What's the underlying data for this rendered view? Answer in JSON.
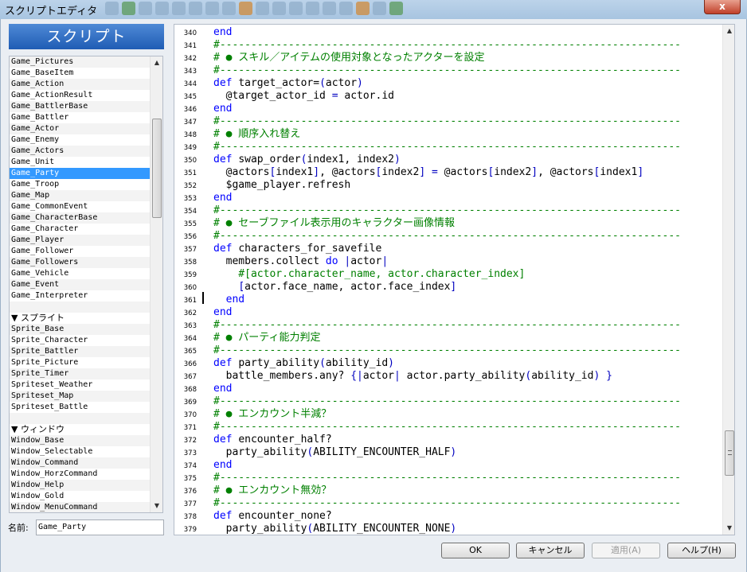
{
  "window": {
    "title": "スクリプトエディタ",
    "close_label": "x",
    "accent": "#1f5cb4",
    "selection_color": "#3399ff"
  },
  "left_panel": {
    "header": "スクリプト",
    "items": [
      {
        "label": "Game_Pictures"
      },
      {
        "label": "Game_BaseItem"
      },
      {
        "label": "Game_Action"
      },
      {
        "label": "Game_ActionResult"
      },
      {
        "label": "Game_BattlerBase"
      },
      {
        "label": "Game_Battler"
      },
      {
        "label": "Game_Actor"
      },
      {
        "label": "Game_Enemy"
      },
      {
        "label": "Game_Actors"
      },
      {
        "label": "Game_Unit"
      },
      {
        "label": "Game_Party",
        "selected": true
      },
      {
        "label": "Game_Troop"
      },
      {
        "label": "Game_Map"
      },
      {
        "label": "Game_CommonEvent"
      },
      {
        "label": "Game_CharacterBase"
      },
      {
        "label": "Game_Character"
      },
      {
        "label": "Game_Player"
      },
      {
        "label": "Game_Follower"
      },
      {
        "label": "Game_Followers"
      },
      {
        "label": "Game_Vehicle"
      },
      {
        "label": "Game_Event"
      },
      {
        "label": "Game_Interpreter"
      },
      {
        "gap": true
      },
      {
        "category": "▼ スプライト"
      },
      {
        "label": "Sprite_Base"
      },
      {
        "label": "Sprite_Character"
      },
      {
        "label": "Sprite_Battler"
      },
      {
        "label": "Sprite_Picture"
      },
      {
        "label": "Sprite_Timer"
      },
      {
        "label": "Spriteset_Weather"
      },
      {
        "label": "Spriteset_Map"
      },
      {
        "label": "Spriteset_Battle"
      },
      {
        "gap": true
      },
      {
        "category": "▼ ウィンドウ"
      },
      {
        "label": "Window_Base"
      },
      {
        "label": "Window_Selectable"
      },
      {
        "label": "Window_Command"
      },
      {
        "label": "Window_HorzCommand"
      },
      {
        "label": "Window_Help"
      },
      {
        "label": "Window_Gold"
      },
      {
        "label": "Window_MenuCommand"
      }
    ],
    "name_label": "名前:",
    "name_value": "Game_Party"
  },
  "editor": {
    "lines": [
      {
        "n": "340",
        "t": "kw",
        "text": "end"
      },
      {
        "n": "341",
        "t": "cm",
        "text": "#--------------------------------------------------------------------------"
      },
      {
        "n": "342",
        "t": "cm",
        "text": "# ● スキル／アイテムの使用対象となったアクターを設定"
      },
      {
        "n": "343",
        "t": "cm",
        "text": "#--------------------------------------------------------------------------"
      },
      {
        "n": "344",
        "t": "mix",
        "parts": [
          [
            "kw",
            "def "
          ],
          [
            "pl",
            "target_actor="
          ],
          [
            "sy",
            "("
          ],
          [
            "pl",
            "actor"
          ],
          [
            "sy",
            ")"
          ]
        ]
      },
      {
        "n": "345",
        "t": "mix",
        "parts": [
          [
            "pl",
            "  @target_actor_id "
          ],
          [
            "sy",
            "="
          ],
          [
            "pl",
            " actor.id"
          ]
        ]
      },
      {
        "n": "346",
        "t": "kw",
        "text": "end"
      },
      {
        "n": "347",
        "t": "cm",
        "text": "#--------------------------------------------------------------------------"
      },
      {
        "n": "348",
        "t": "cm",
        "text": "# ● 順序入れ替え"
      },
      {
        "n": "349",
        "t": "cm",
        "text": "#--------------------------------------------------------------------------"
      },
      {
        "n": "350",
        "t": "mix",
        "parts": [
          [
            "kw",
            "def "
          ],
          [
            "pl",
            "swap_order"
          ],
          [
            "sy",
            "("
          ],
          [
            "pl",
            "index1, index2"
          ],
          [
            "sy",
            ")"
          ]
        ]
      },
      {
        "n": "351",
        "t": "mix",
        "parts": [
          [
            "pl",
            "  @actors"
          ],
          [
            "sy",
            "["
          ],
          [
            "pl",
            "index1"
          ],
          [
            "sy",
            "]"
          ],
          [
            "pl",
            ", @actors"
          ],
          [
            "sy",
            "["
          ],
          [
            "pl",
            "index2"
          ],
          [
            "sy",
            "]"
          ],
          [
            "pl",
            " "
          ],
          [
            "sy",
            "="
          ],
          [
            "pl",
            " @actors"
          ],
          [
            "sy",
            "["
          ],
          [
            "pl",
            "index2"
          ],
          [
            "sy",
            "]"
          ],
          [
            "pl",
            ", @actors"
          ],
          [
            "sy",
            "["
          ],
          [
            "pl",
            "index1"
          ],
          [
            "sy",
            "]"
          ]
        ]
      },
      {
        "n": "352",
        "t": "mix",
        "parts": [
          [
            "pl",
            "  $game_player.refresh"
          ]
        ]
      },
      {
        "n": "353",
        "t": "kw",
        "text": "end"
      },
      {
        "n": "354",
        "t": "cm",
        "text": "#--------------------------------------------------------------------------"
      },
      {
        "n": "355",
        "t": "cm",
        "text": "# ● セーブファイル表示用のキャラクター画像情報"
      },
      {
        "n": "356",
        "t": "cm",
        "text": "#--------------------------------------------------------------------------"
      },
      {
        "n": "357",
        "t": "mix",
        "parts": [
          [
            "kw",
            "def "
          ],
          [
            "pl",
            "characters_for_savefile"
          ]
        ]
      },
      {
        "n": "358",
        "t": "mix",
        "parts": [
          [
            "pl",
            "  members.collect "
          ],
          [
            "kw",
            "do"
          ],
          [
            "pl",
            " "
          ],
          [
            "sy",
            "|"
          ],
          [
            "pl",
            "actor"
          ],
          [
            "sy",
            "|"
          ]
        ]
      },
      {
        "n": "359",
        "t": "cm",
        "text": "    #[actor.character_name, actor.character_index]"
      },
      {
        "n": "360",
        "t": "mix",
        "parts": [
          [
            "pl",
            "    "
          ],
          [
            "sy",
            "["
          ],
          [
            "pl",
            "actor.face_name, actor.face_index"
          ],
          [
            "sy",
            "]"
          ]
        ]
      },
      {
        "n": "361",
        "t": "kw",
        "text": "  end"
      },
      {
        "n": "362",
        "t": "kw",
        "text": "end"
      },
      {
        "n": "363",
        "t": "cm",
        "text": "#--------------------------------------------------------------------------"
      },
      {
        "n": "364",
        "t": "cm",
        "text": "# ● パーティ能力判定"
      },
      {
        "n": "365",
        "t": "cm",
        "text": "#--------------------------------------------------------------------------"
      },
      {
        "n": "366",
        "t": "mix",
        "parts": [
          [
            "kw",
            "def "
          ],
          [
            "pl",
            "party_ability"
          ],
          [
            "sy",
            "("
          ],
          [
            "pl",
            "ability_id"
          ],
          [
            "sy",
            ")"
          ]
        ]
      },
      {
        "n": "367",
        "t": "mix",
        "parts": [
          [
            "pl",
            "  battle_members.any? "
          ],
          [
            "sy",
            "{|"
          ],
          [
            "pl",
            "actor"
          ],
          [
            "sy",
            "|"
          ],
          [
            "pl",
            " actor.party_ability"
          ],
          [
            "sy",
            "("
          ],
          [
            "pl",
            "ability_id"
          ],
          [
            "sy",
            ")"
          ],
          [
            "pl",
            " "
          ],
          [
            "sy",
            "}"
          ]
        ]
      },
      {
        "n": "368",
        "t": "kw",
        "text": "end"
      },
      {
        "n": "369",
        "t": "cm",
        "text": "#--------------------------------------------------------------------------"
      },
      {
        "n": "370",
        "t": "cm",
        "text": "# ● エンカウント半減？"
      },
      {
        "n": "371",
        "t": "cm",
        "text": "#--------------------------------------------------------------------------"
      },
      {
        "n": "372",
        "t": "mix",
        "parts": [
          [
            "kw",
            "def "
          ],
          [
            "pl",
            "encounter_half?"
          ]
        ]
      },
      {
        "n": "373",
        "t": "mix",
        "parts": [
          [
            "pl",
            "  party_ability"
          ],
          [
            "sy",
            "("
          ],
          [
            "pl",
            "ABILITY_ENCOUNTER_HALF"
          ],
          [
            "sy",
            ")"
          ]
        ]
      },
      {
        "n": "374",
        "t": "kw",
        "text": "end"
      },
      {
        "n": "375",
        "t": "cm",
        "text": "#--------------------------------------------------------------------------"
      },
      {
        "n": "376",
        "t": "cm",
        "text": "# ● エンカウント無効？"
      },
      {
        "n": "377",
        "t": "cm",
        "text": "#--------------------------------------------------------------------------"
      },
      {
        "n": "378",
        "t": "mix",
        "parts": [
          [
            "kw",
            "def "
          ],
          [
            "pl",
            "encounter_none?"
          ]
        ]
      },
      {
        "n": "379",
        "t": "mix",
        "parts": [
          [
            "pl",
            "  party_ability"
          ],
          [
            "sy",
            "("
          ],
          [
            "pl",
            "ABILITY_ENCOUNTER_NONE"
          ],
          [
            "sy",
            ")"
          ]
        ]
      }
    ],
    "colors": {
      "keyword": "#0000ff",
      "comment": "#008000",
      "symbol": "#0000c0"
    }
  },
  "buttons": {
    "ok": "OK",
    "cancel": "キャンセル",
    "apply": "適用(A)",
    "help": "ヘルプ(H)"
  }
}
